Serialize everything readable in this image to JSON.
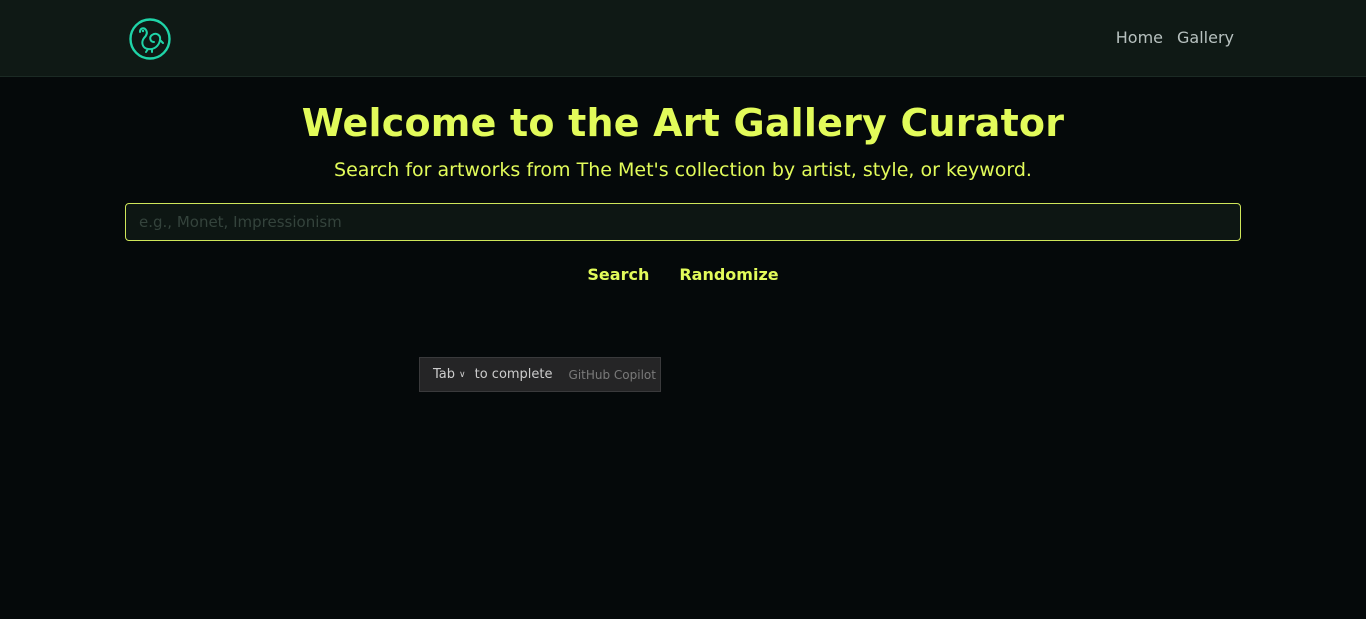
{
  "nav": {
    "logo_icon": "bird-circle-icon",
    "links": [
      {
        "label": "Home"
      },
      {
        "label": "Gallery"
      }
    ]
  },
  "hero": {
    "title": "Welcome to the Art Gallery Curator",
    "subtitle": "Search for artworks from The Met's collection by artist, style, or keyword."
  },
  "search": {
    "value": "",
    "placeholder": "e.g., Monet, Impressionism",
    "search_label": "Search",
    "randomize_label": "Randomize"
  },
  "copilot_hint": {
    "key": "Tab",
    "action": "to complete",
    "source": "GitHub Copilot"
  },
  "colors": {
    "accent": "#e2fb5a",
    "logo": "#1fd4a8",
    "background": "#05090a",
    "navbar": "#0f1915"
  }
}
